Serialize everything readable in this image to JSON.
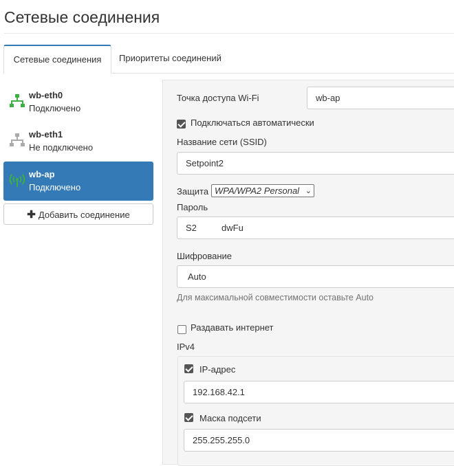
{
  "page": {
    "title": "Сетевые соединения"
  },
  "tabs": [
    {
      "label": "Сетевые соединения",
      "active": true
    },
    {
      "label": "Приоритеты соединений",
      "active": false
    }
  ],
  "connections": [
    {
      "name": "wb-eth0",
      "status": "Подключено",
      "icon": "ethernet-icon",
      "icon_color": "#3cb043",
      "active": false
    },
    {
      "name": "wb-eth1",
      "status": "Не подключено",
      "icon": "ethernet-icon",
      "icon_color": "#aaaaaa",
      "active": false
    },
    {
      "name": "wb-ap",
      "status": "Подключено",
      "icon": "wifi-ap-icon",
      "icon_color": "#3cb043",
      "active": true
    }
  ],
  "add_button": {
    "label": "Добавить соединение"
  },
  "form": {
    "wifi_ap": {
      "label": "Точка доступа Wi-Fi",
      "value": "wb-ap"
    },
    "autoconnect": {
      "label": "Подключаться автоматически",
      "checked": true
    },
    "ssid": {
      "label": "Название сети (SSID)",
      "value": "Setpoint2"
    },
    "security": {
      "label": "Защита",
      "value": "WPA/WPA2 Personal"
    },
    "password": {
      "label": "Пароль",
      "value": "S2          dwFu"
    },
    "encryption": {
      "label": "Шифрование",
      "value": "Auto",
      "hint": "Для максимальной совместимости оставьте Auto"
    },
    "share_internet": {
      "label": "Раздавать интернет",
      "checked": false
    },
    "ipv4": {
      "label": "IPv4",
      "ip": {
        "label": "IP-адрес",
        "checked": true,
        "value": "192.168.42.1"
      },
      "mask": {
        "label": "Маска подсети",
        "checked": true,
        "value": "255.255.255.0"
      }
    }
  },
  "colors": {
    "accent": "#337ab7",
    "connected": "#3cb043",
    "disconnected": "#aaaaaa"
  }
}
